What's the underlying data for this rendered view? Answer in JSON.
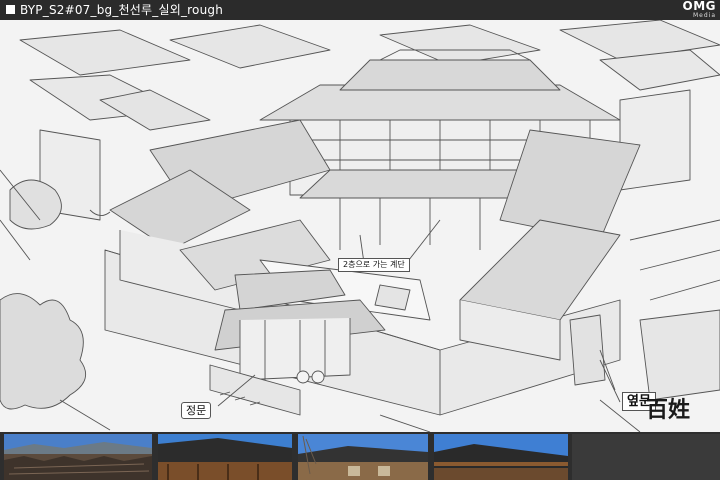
{
  "window": {
    "title": "BYP_S2#07_bg_천선루_실외_rough"
  },
  "logo": {
    "main": "OMG",
    "sub": "Media"
  },
  "annotations": {
    "stairs": "2층으로 가는 계단",
    "main_gate": "정문",
    "side_gate": "옆문"
  },
  "brand_stamp": "百姓",
  "reference_photos": [
    {
      "name": "town-rooftops-photo"
    },
    {
      "name": "wooden-building-photo"
    },
    {
      "name": "courtyard-facade-photo"
    },
    {
      "name": "tiled-roof-photo"
    }
  ],
  "colors": {
    "titlebar": "#2b2b2b",
    "sketch_paper": "#f3f3f3",
    "line": "#555555",
    "strip": "#2e2e2e",
    "sky": "#3d7fd0"
  }
}
